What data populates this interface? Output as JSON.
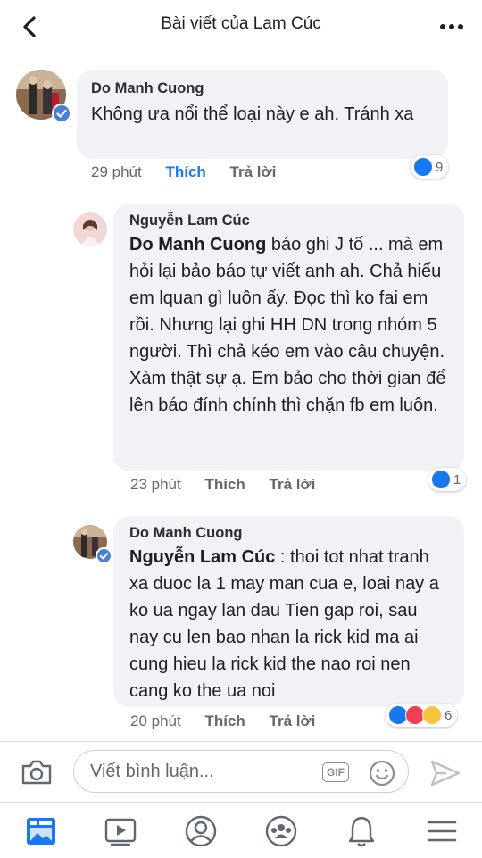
{
  "header": {
    "title": "Bài viết của Lam Cúc",
    "back_icon": "back-arrow-icon",
    "more_icon": "more-options-icon"
  },
  "comments": [
    {
      "author": "Do Manh Cuong",
      "text": "Không ưa nổi thể loại này e ah. Tránh xa",
      "time": "29 phút",
      "like_label": "Thích",
      "like_active": true,
      "reply_label": "Trả lời",
      "reactions": [
        "like"
      ],
      "reaction_count": "9",
      "verified": true
    },
    {
      "author": "Nguyễn Lam Cúc",
      "mention": "Do Manh Cuong",
      "text": " báo ghi J tố ... mà em hỏi lại bảo báo tự viết anh ah. Chả hiểu em lquan gì luôn ấy. Đọc thì ko fai em rồi. Nhưng lại ghi HH DN trong nhóm 5 người. Thì chả kéo em vào câu chuyện. Xàm thật sự ạ. Em bảo cho thời gian để lên báo đính chính thì chặn fb em luôn.",
      "time": "23 phút",
      "like_label": "Thích",
      "like_active": false,
      "reply_label": "Trả lời",
      "reactions": [
        "like"
      ],
      "reaction_count": "1",
      "verified": false
    },
    {
      "author": "Do Manh Cuong",
      "mention": "Nguyễn Lam Cúc",
      "text": " : thoi tot nhat tranh xa duoc la 1 may man cua e, loai nay a ko ua ngay lan dau Tien gap roi, sau nay cu len bao nhan la rick kid ma ai cung hieu la rick kid the nao roi nen cang ko the ua noi",
      "time": "20 phút",
      "like_label": "Thích",
      "like_active": false,
      "reply_label": "Trả lời",
      "reactions": [
        "like",
        "love",
        "wow"
      ],
      "reaction_count": "6",
      "verified": true
    }
  ],
  "composer": {
    "placeholder": "Viết bình luận...",
    "gif_label": "GIF",
    "camera_icon": "camera-icon",
    "emoji_icon": "emoji-icon",
    "send_icon": "send-icon"
  },
  "bottom_nav": {
    "items": [
      "news-feed-icon",
      "video-icon",
      "profile-icon",
      "groups-icon",
      "notifications-icon",
      "menu-icon"
    ]
  },
  "colors": {
    "accent": "#1877f2",
    "bubble": "#f0f2f5",
    "muted": "#65676b"
  }
}
